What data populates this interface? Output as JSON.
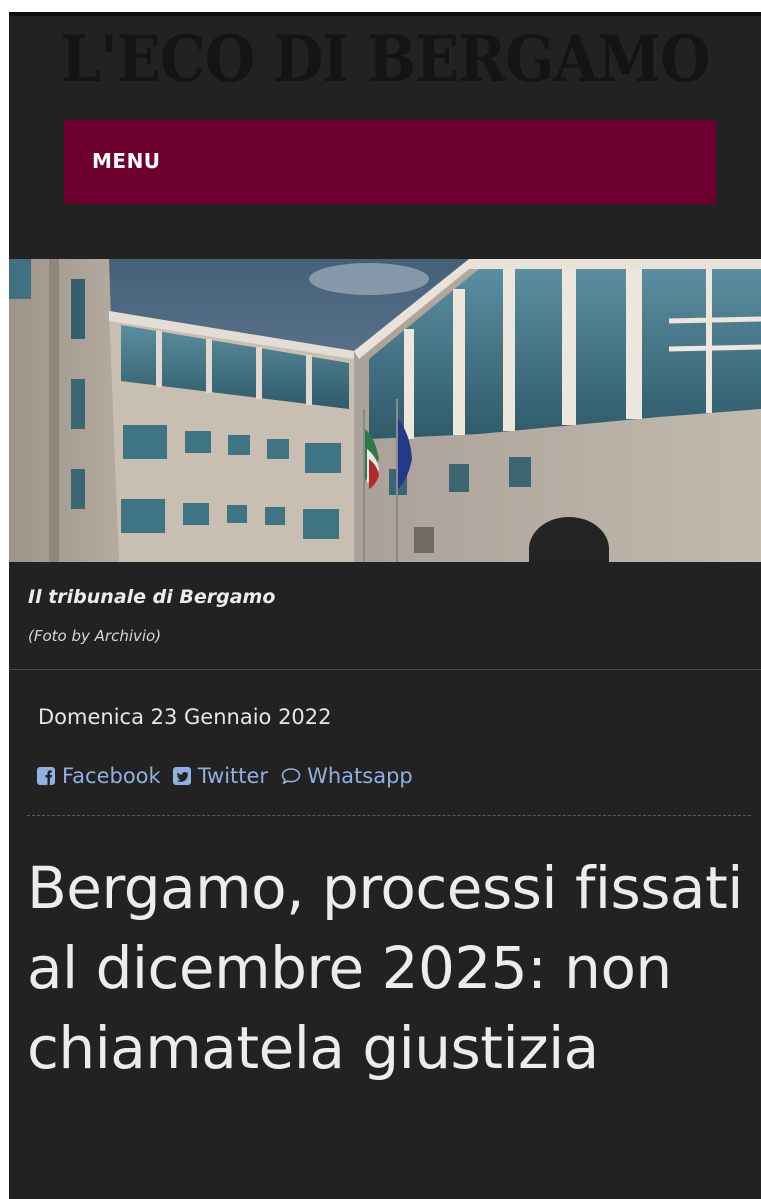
{
  "masthead": {
    "title": "L'ECO DI BERGAMO"
  },
  "nav": {
    "menu_label": "MENU",
    "menu_color": "#6e0030"
  },
  "photo": {
    "caption": "Il tribunale di Bergamo",
    "credit": "(Foto by Archivio)"
  },
  "article": {
    "date": "Domenica 23 Gennaio 2022",
    "headline": "Bergamo, processi fissati al dicembre 2025: non chiamatela giustizia"
  },
  "share": {
    "facebook": {
      "label": "Facebook",
      "icon": "facebook-icon"
    },
    "twitter": {
      "label": "Twitter",
      "icon": "twitter-icon"
    },
    "whatsapp": {
      "label": "Whatsapp",
      "icon": "speech-bubble-icon"
    },
    "link_color": "#8fb0e0"
  },
  "colors": {
    "background": "#222222",
    "text": "#ececec"
  }
}
